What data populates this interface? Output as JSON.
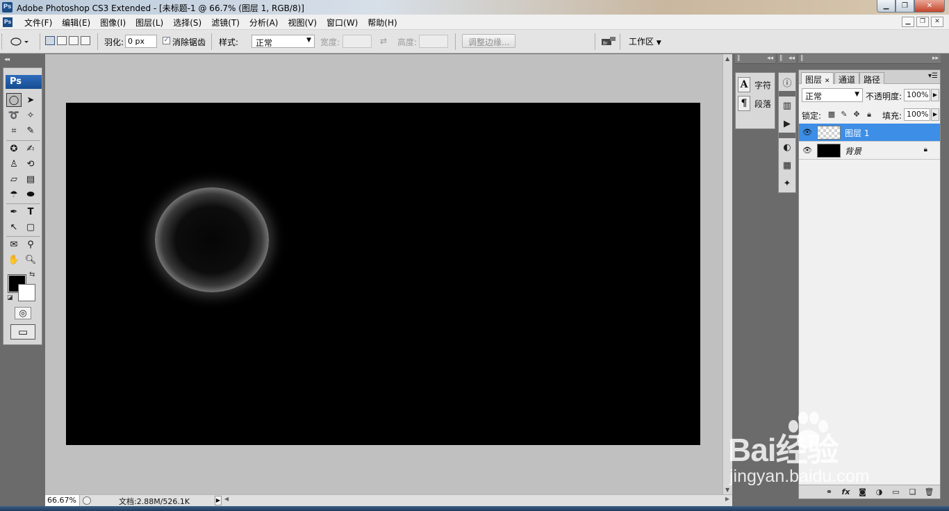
{
  "window": {
    "app_icon": "Ps",
    "title": "Adobe Photoshop CS3 Extended - [未标题-1 @ 66.7% (图层 1, RGB/8)]",
    "controls": [
      "minimize-icon",
      "maximize-icon",
      "close-icon"
    ]
  },
  "menubar": {
    "icon": "Ps",
    "items": [
      "文件(F)",
      "编辑(E)",
      "图像(I)",
      "图层(L)",
      "选择(S)",
      "滤镜(T)",
      "分析(A)",
      "视图(V)",
      "窗口(W)",
      "帮助(H)"
    ]
  },
  "options": {
    "feather_label": "羽化:",
    "feather_value": "0 px",
    "antialias_label": "消除锯齿",
    "antialias_checked": true,
    "style_label": "样式:",
    "style_value": "正常",
    "width_label": "宽度:",
    "height_label": "高度:",
    "refine_edge_label": "调整边缘...",
    "workspace_label": "工作区"
  },
  "tools": {
    "badge": "Ps",
    "foreground_color": "#000000",
    "background_color": "#ffffff",
    "items": [
      "elliptical-marquee-icon",
      "move-icon",
      "lasso-icon",
      "magic-wand-icon",
      "crop-icon",
      "slice-icon",
      "healing-brush-icon",
      "brush-icon",
      "clone-stamp-icon",
      "history-brush-icon",
      "eraser-icon",
      "gradient-icon",
      "blur-icon",
      "dodge-icon",
      "pen-icon",
      "type-icon",
      "path-selection-icon",
      "rectangle-shape-icon",
      "notes-icon",
      "eyedropper-icon",
      "hand-icon",
      "zoom-icon"
    ]
  },
  "document": {
    "background_color": "#000000",
    "zoom": "66.67%",
    "doc_info": "文档:2.88M/526.1K"
  },
  "character_panel": {
    "character_label": "字符",
    "paragraph_label": "段落"
  },
  "dock_icons": [
    "info-icon",
    "histogram-icon",
    "actions-icon",
    "color-icon",
    "swatches-icon",
    "styles-icon"
  ],
  "layers_panel": {
    "tabs": [
      "图层",
      "通道",
      "路径"
    ],
    "blend_mode": "正常",
    "opacity_label": "不透明度:",
    "opacity_value": "100%",
    "lock_label": "锁定:",
    "fill_label": "填充:",
    "fill_value": "100%",
    "layers": [
      {
        "name": "图层 1",
        "selected": true
      },
      {
        "name": "背景",
        "selected": false,
        "locked": true
      }
    ],
    "footer_icons": [
      "link-layers-icon",
      "fx-icon",
      "add-mask-icon",
      "adjustment-layer-icon",
      "new-group-icon",
      "new-layer-icon",
      "delete-layer-icon"
    ]
  },
  "watermark": {
    "main": "Bai经验",
    "sub": "jingyan.baidu.com"
  }
}
